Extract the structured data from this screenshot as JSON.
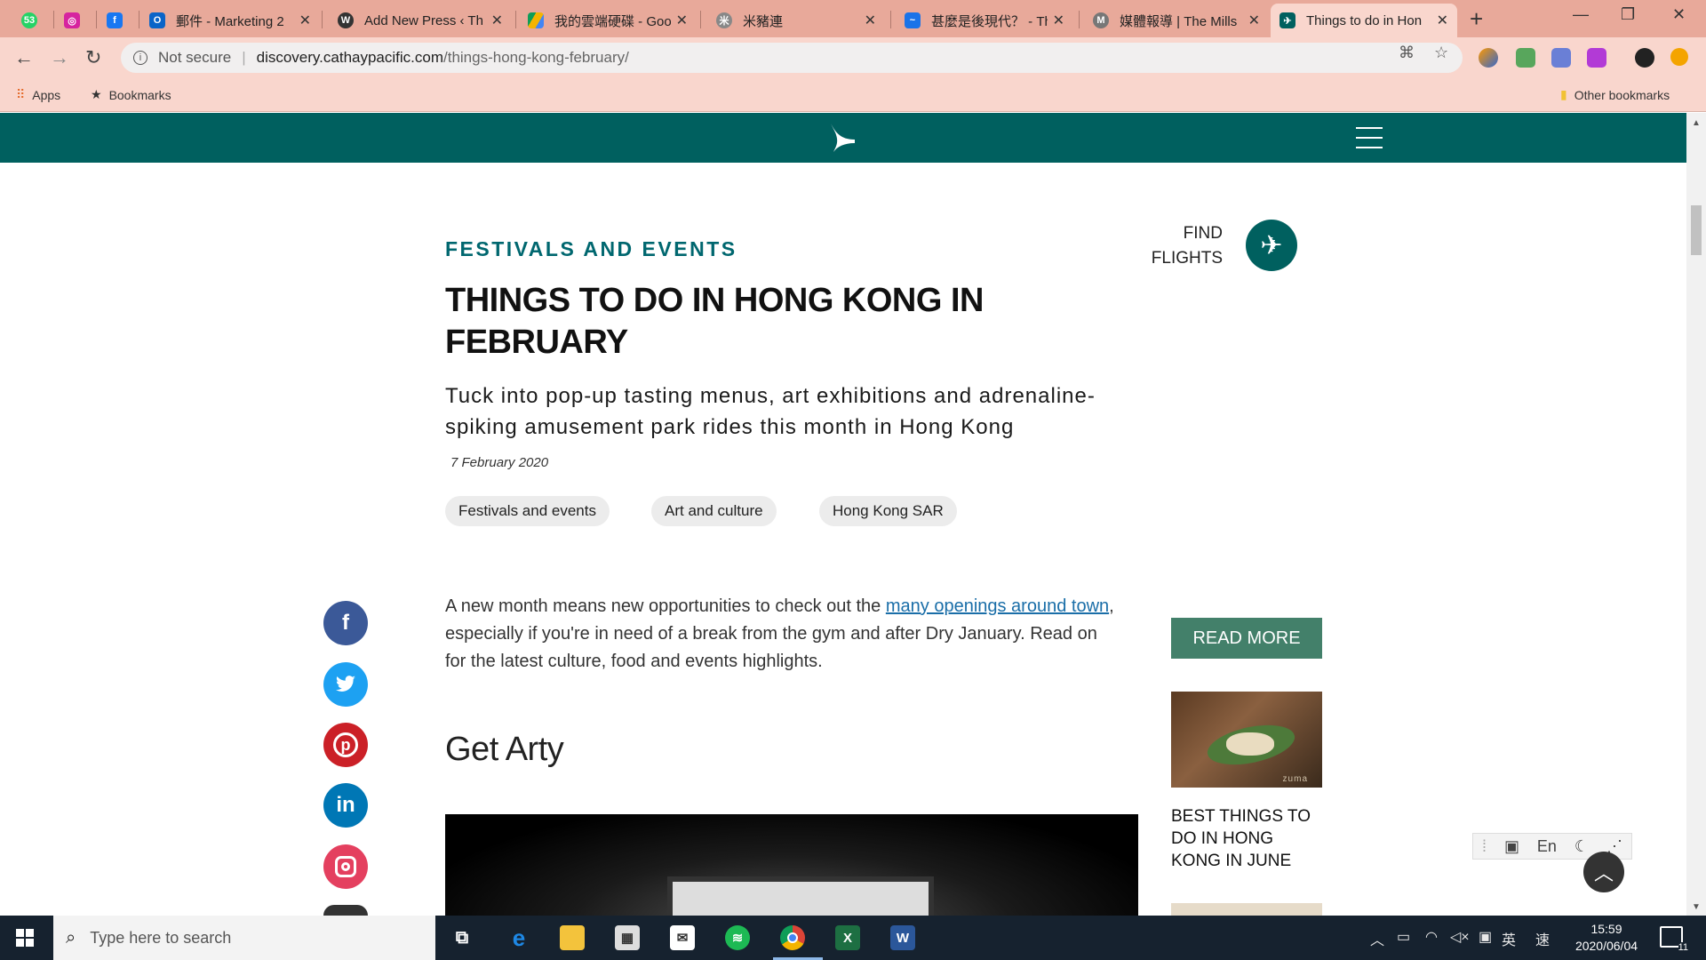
{
  "browser": {
    "tabs": [
      {
        "title": "",
        "icon": "whatsapp-icon",
        "color": "#25d366",
        "badge": "53"
      },
      {
        "title": "",
        "icon": "instagram-icon",
        "color": "#d6249f"
      },
      {
        "title": "",
        "icon": "facebook-icon",
        "color": "#1877f2"
      },
      {
        "title": "郵件 - Marketing 2",
        "icon": "outlook-icon",
        "color": "#0a64c8"
      },
      {
        "title": "Add New Press ‹ Th",
        "icon": "wordpress-icon",
        "color": "#333333"
      },
      {
        "title": "我的雲端硬碟 - Goo",
        "icon": "google-drive-icon",
        "color": "#f4b400"
      },
      {
        "title": "米豬連",
        "icon": "michelin-icon",
        "color": "#888888"
      },
      {
        "title": "甚麼是後現代？ - Th",
        "icon": "analytics-icon",
        "color": "#1a73e8"
      },
      {
        "title": "媒體報導 | The Mills",
        "icon": "mills-icon",
        "color": "#777777"
      },
      {
        "title": "Things to do in Hon",
        "icon": "cathay-icon",
        "color": "#00605f",
        "active": true
      }
    ],
    "address": {
      "security": "Not secure",
      "domain": "discovery.cathaypacific.com",
      "path": "/things-hong-kong-february/"
    },
    "bookmarks": {
      "apps": "Apps",
      "bookmarks": "Bookmarks",
      "other": "Other bookmarks"
    }
  },
  "article": {
    "kicker": "FESTIVALS AND EVENTS",
    "title": "THINGS TO DO IN HONG KONG IN FEBRUARY",
    "subtitle": "Tuck into pop-up tasting menus, art exhibitions and adrenaline-spiking amusement park rides this month in Hong Kong",
    "date": "7 February 2020",
    "tags": [
      "Festivals and events",
      "Art and culture",
      "Hong Kong SAR"
    ],
    "body_before": "A new month means new opportunities to check out the ",
    "body_link": "many openings around town",
    "body_after": ", especially if you're in need of a break from the gym and after Dry January. Read on for the latest culture, food and events highlights.",
    "section_heading": "Get Arty"
  },
  "find_flights": "FIND FLIGHTS",
  "social": [
    {
      "name": "facebook",
      "glyph": "f",
      "color": "#3b5998"
    },
    {
      "name": "twitter",
      "glyph": "t",
      "color": "#1da1f2"
    },
    {
      "name": "pinterest",
      "glyph": "p",
      "color": "#cb2027"
    },
    {
      "name": "linkedin",
      "glyph": "in",
      "color": "#0077b5"
    },
    {
      "name": "instagram",
      "glyph": "◎",
      "color": "#e4405f"
    }
  ],
  "sidebar": {
    "read_more": "READ MORE",
    "card_title": "BEST THINGS TO DO IN HONG KONG IN JUNE",
    "card_image_brand": "zuma"
  },
  "ime": {
    "lang": "En"
  },
  "taskbar": {
    "search_placeholder": "Type here to search",
    "time": "15:59",
    "date": "2020/06/04",
    "ime_char": "英",
    "ime_char2": "速",
    "notifications": "11"
  },
  "colors": {
    "brand": "#00605f",
    "kicker": "#00676f",
    "read_more": "#43806a",
    "link": "#1a6ea8"
  }
}
